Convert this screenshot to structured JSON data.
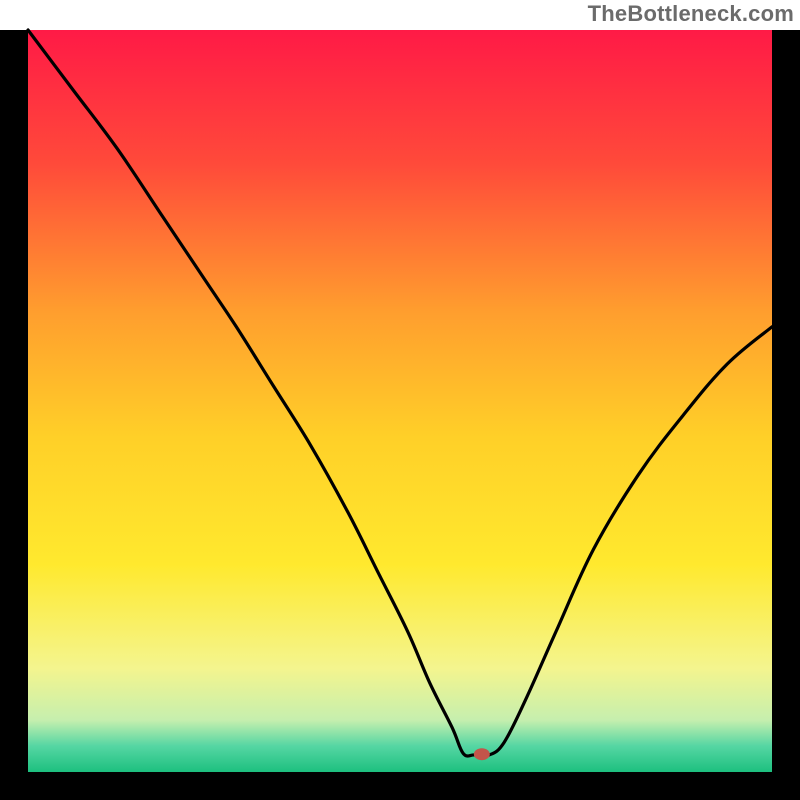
{
  "watermark": "TheBottleneck.com",
  "chart_data": {
    "type": "line",
    "title": "",
    "xlabel": "",
    "ylabel": "",
    "xlim": [
      0,
      100
    ],
    "ylim": [
      0,
      100
    ],
    "background": {
      "type": "vertical-gradient",
      "stops": [
        {
          "pos": 0.0,
          "color": "#ff1a46"
        },
        {
          "pos": 0.18,
          "color": "#ff4a3a"
        },
        {
          "pos": 0.38,
          "color": "#ff9e2e"
        },
        {
          "pos": 0.55,
          "color": "#ffd028"
        },
        {
          "pos": 0.72,
          "color": "#ffe92e"
        },
        {
          "pos": 0.86,
          "color": "#f4f58e"
        },
        {
          "pos": 0.93,
          "color": "#c6efae"
        },
        {
          "pos": 0.965,
          "color": "#55d6a3"
        },
        {
          "pos": 1.0,
          "color": "#1dc07f"
        }
      ]
    },
    "series": [
      {
        "name": "bottleneck-curve",
        "x": [
          0,
          6,
          12,
          18,
          24,
          28,
          33,
          38,
          43,
          47,
          51,
          54,
          57,
          58.5,
          60,
          62,
          64,
          67,
          71,
          76,
          82,
          88,
          94,
          100
        ],
        "y": [
          100,
          92,
          84,
          75,
          66,
          60,
          52,
          44,
          35,
          27,
          19,
          12,
          6,
          2.5,
          2.3,
          2.3,
          4,
          10,
          19,
          30,
          40,
          48,
          55,
          60
        ]
      }
    ],
    "marker": {
      "x": 61,
      "y": 2.4,
      "color": "#c2554a",
      "rx": 8,
      "ry": 6
    },
    "frame": {
      "stroke": "#000000",
      "width": 28
    }
  }
}
